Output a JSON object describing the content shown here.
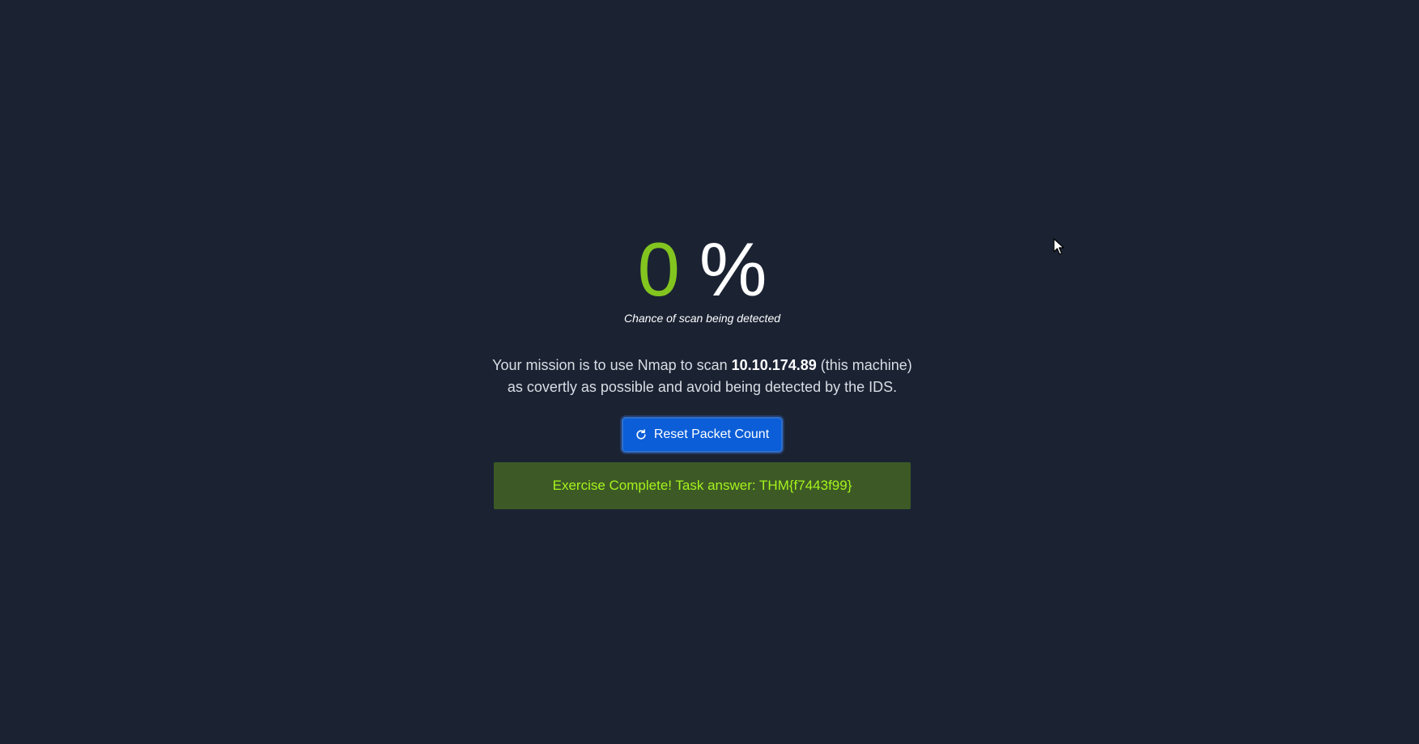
{
  "score": {
    "value": "0",
    "unit": "%",
    "caption": "Chance of scan being detected"
  },
  "mission": {
    "prefix": "Your mission is to use Nmap to scan ",
    "ip": "10.10.174.89",
    "suffix": " (this machine)",
    "line2": "as covertly as possible and avoid being detected by the IDS."
  },
  "reset_button": {
    "label": "Reset Packet Count",
    "icon": "refresh-icon"
  },
  "banner": {
    "text": "Exercise Complete! Task answer: THM{f7443f99}"
  },
  "colors": {
    "background": "#1b2333",
    "score_accent": "#83c51f",
    "button": "#0b5ed7",
    "banner_bg": "#3d5a26",
    "banner_text": "#a5f31c"
  }
}
